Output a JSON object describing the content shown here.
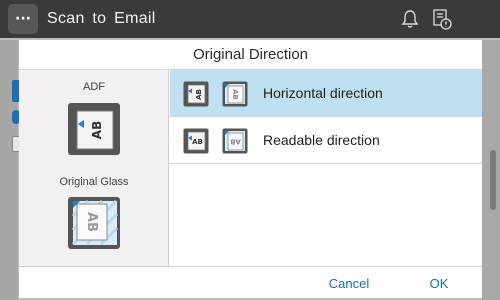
{
  "app": {
    "title": "Scan to Email",
    "menu_label": "···"
  },
  "dialog": {
    "title": "Original Direction",
    "left": {
      "adf_label": "ADF",
      "glass_label": "Original Glass"
    },
    "options": [
      {
        "label": "Horizontal direction",
        "selected": true
      },
      {
        "label": "Readable direction",
        "selected": false
      }
    ],
    "buttons": {
      "cancel": "Cancel",
      "ok": "OK"
    }
  },
  "colors": {
    "accent": "#1d6ab0",
    "selected_row": "#bfe0f0",
    "topbar": "#3a3a3a"
  }
}
